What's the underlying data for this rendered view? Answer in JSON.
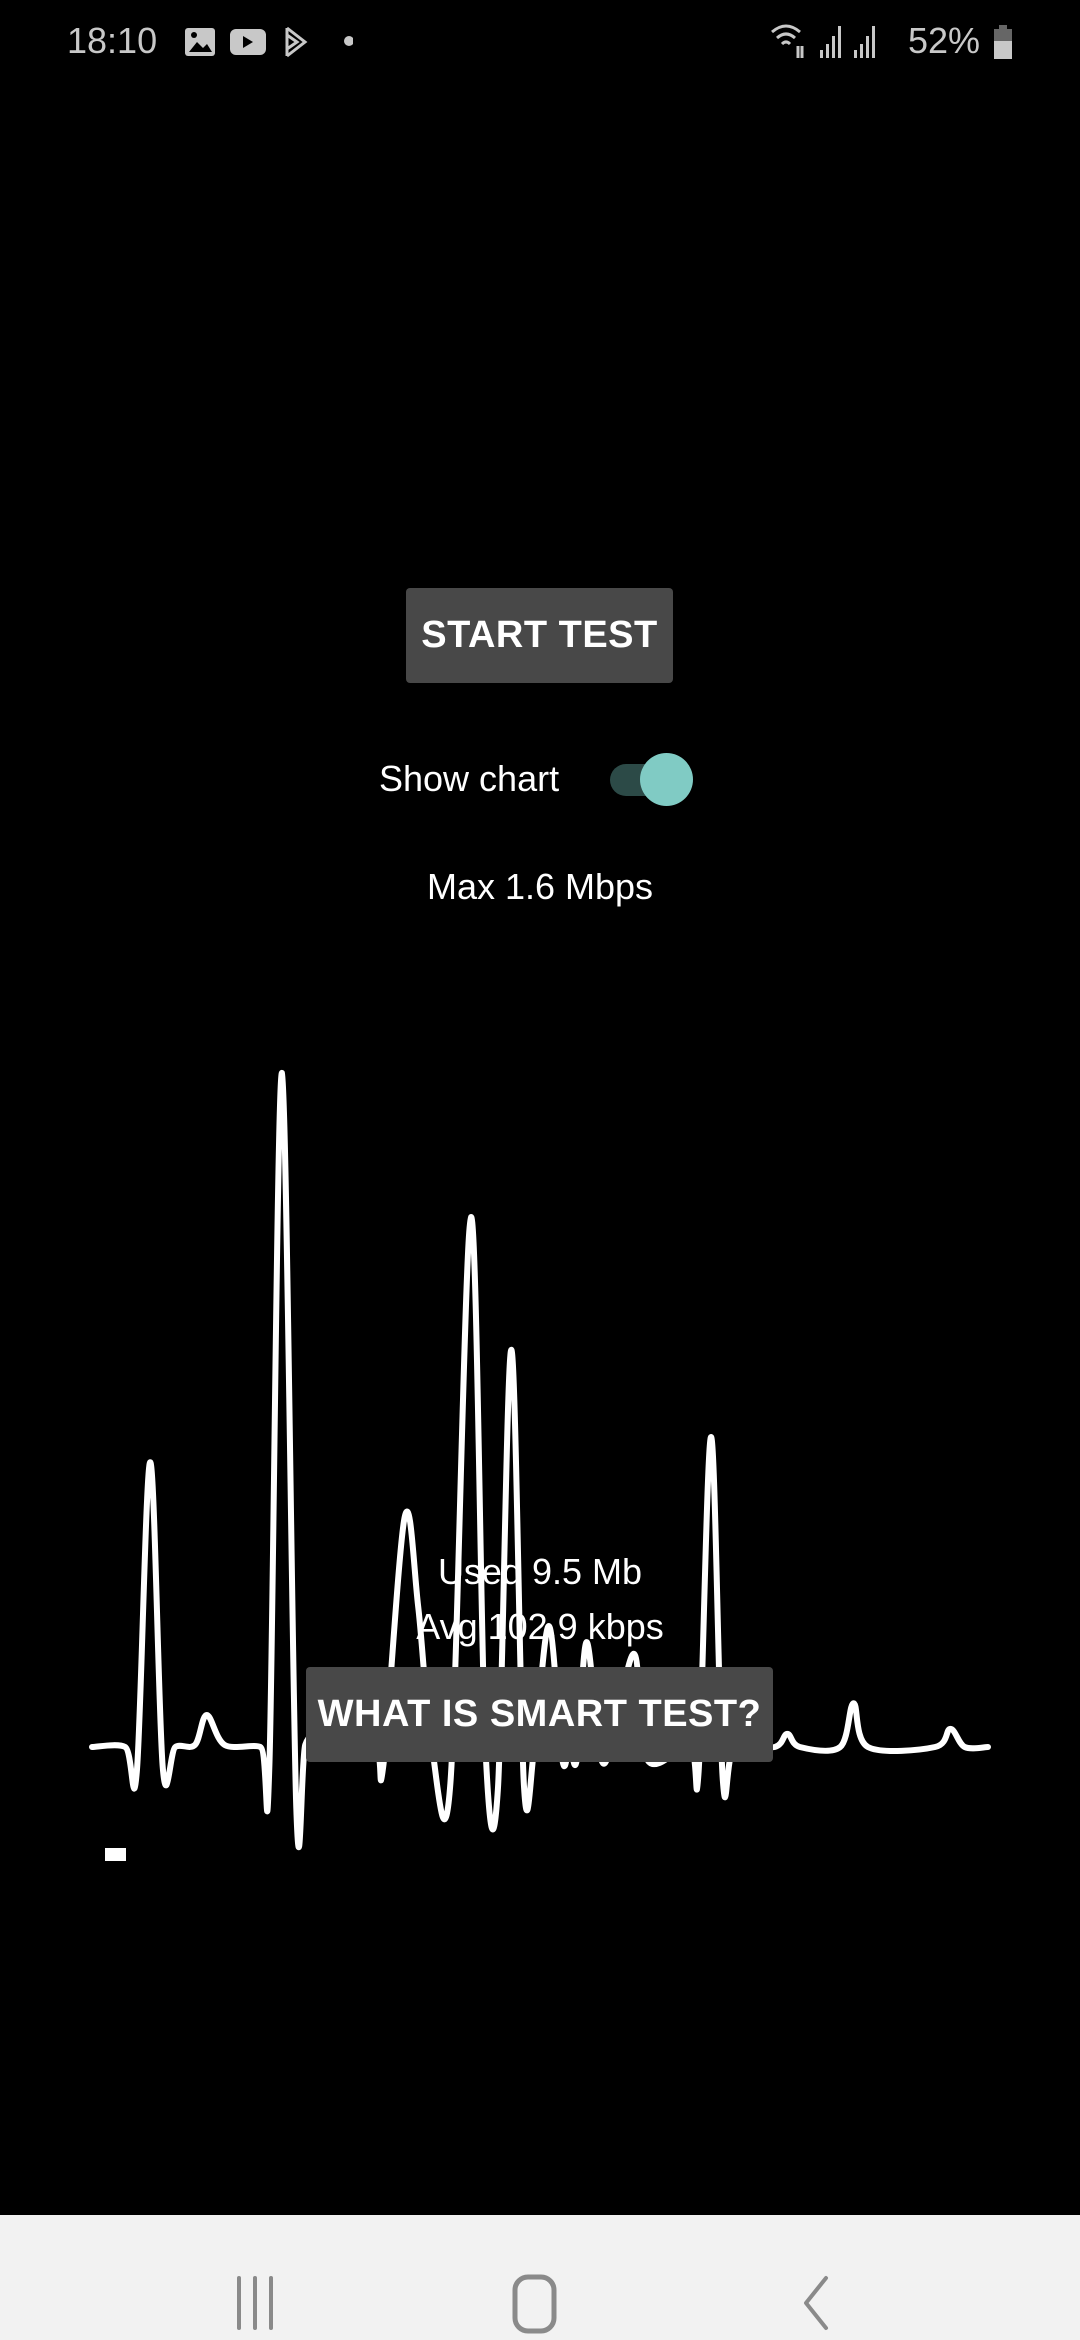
{
  "status_bar": {
    "time": "18:10",
    "battery_percent": "52%",
    "notification_icons": [
      "gallery-icon",
      "youtube-icon",
      "play-store-icon",
      "dot-icon"
    ],
    "system_icons": [
      "wifi-icon",
      "signal-icon",
      "signal-icon",
      "battery-icon"
    ]
  },
  "main": {
    "start_button": "START TEST",
    "show_chart_label": "Show chart",
    "show_chart_on": true,
    "max_text": "Max 1.6 Mbps",
    "used_text": "Used 9.5 Mb",
    "avg_text": "Avg 102.9 kbps",
    "smart_button": "WHAT IS SMART TEST?"
  },
  "colors": {
    "accent": "#80cbc4",
    "track": "#2c4a47",
    "button": "#484848",
    "line": "#ffffff"
  },
  "chart_data": {
    "type": "line",
    "ylabel": "",
    "xlabel": "",
    "unit": "Mbps",
    "ylim": [
      0,
      1.6
    ],
    "grid": false,
    "x": [
      0,
      3.7,
      5.0,
      6.5,
      7.9,
      9.3,
      11.5,
      12.8,
      14.8,
      18.8,
      19.8,
      21.2,
      22.8,
      23.8,
      25.6,
      27.1,
      31.6,
      32.5,
      34.9,
      36.4,
      37.9,
      40.0,
      42.3,
      43.9,
      45.3,
      46.8,
      48.2,
      49.4,
      51.0,
      52.5,
      53.3,
      54.1,
      55.2,
      56.7,
      58.0,
      60.5,
      62.0,
      66.7,
      67.7,
      69.1,
      70.4,
      71.7,
      76.2,
      77.6,
      79.0,
      83.5,
      85.0,
      86.6,
      94.1,
      95.8,
      97.4,
      100
    ],
    "y": [
      0,
      0,
      -0.059,
      0.676,
      -0.05,
      0,
      0.005,
      0.076,
      0.005,
      0,
      -0.043,
      1.6,
      -0.145,
      0.005,
      0.031,
      0,
      0,
      -0.047,
      0.546,
      0.335,
      0.005,
      -0.086,
      1.258,
      0.005,
      -0.1,
      0.943,
      -0.09,
      0.005,
      0.287,
      -0.031,
      0.005,
      -0.031,
      0.249,
      -0.019,
      0.005,
      0.221,
      -0.031,
      0.005,
      -0.059,
      0.736,
      -0.078,
      0,
      0,
      0.031,
      0,
      0,
      0.104,
      0,
      0,
      0.043,
      0,
      0
    ]
  },
  "nav_bar": {
    "icons": [
      "recents-icon",
      "home-icon",
      "back-icon"
    ]
  }
}
